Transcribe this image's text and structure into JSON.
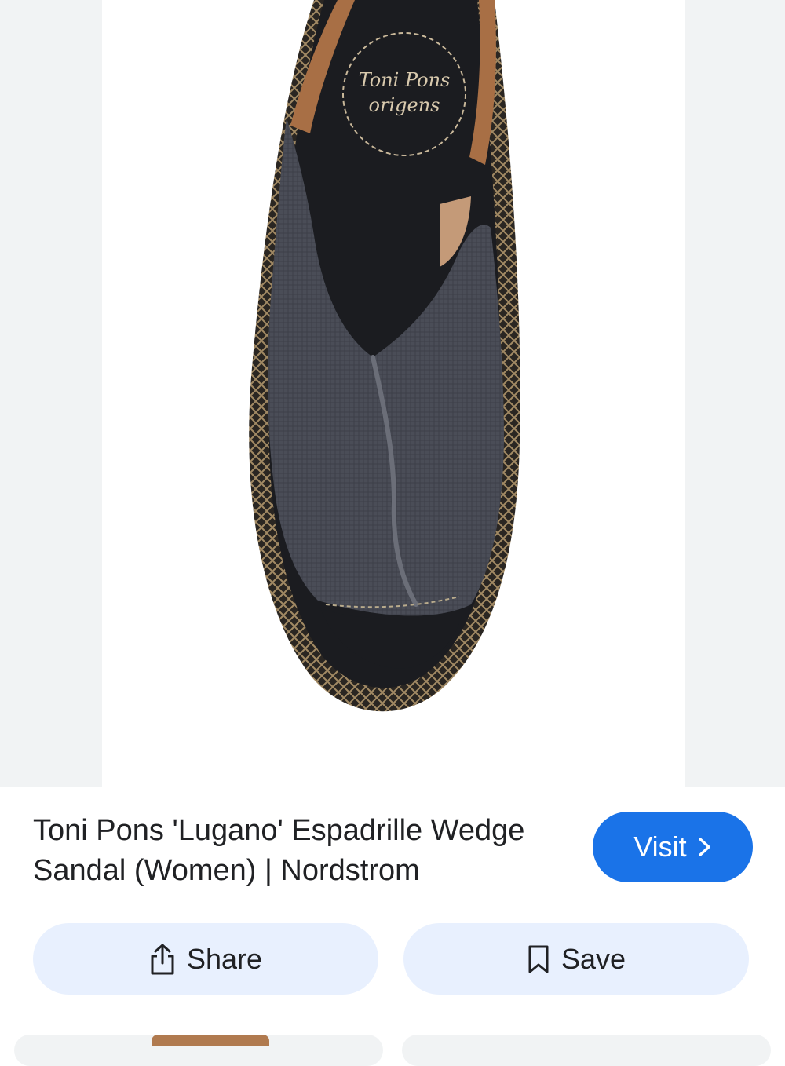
{
  "result": {
    "title": "Toni Pons 'Lugano' Espadrille Wedge Sandal (Women) | Nordstrom",
    "image_logo_text": [
      "Toni Pons",
      "origens"
    ]
  },
  "actions": {
    "visit_label": "Visit",
    "share_label": "Share",
    "save_label": "Save"
  },
  "icons": {
    "visit": "chevron-right-icon",
    "share": "share-icon",
    "save": "bookmark-icon"
  },
  "colors": {
    "accent": "#1a73e8",
    "chip_background": "#e8f0fe",
    "text": "#202124"
  }
}
